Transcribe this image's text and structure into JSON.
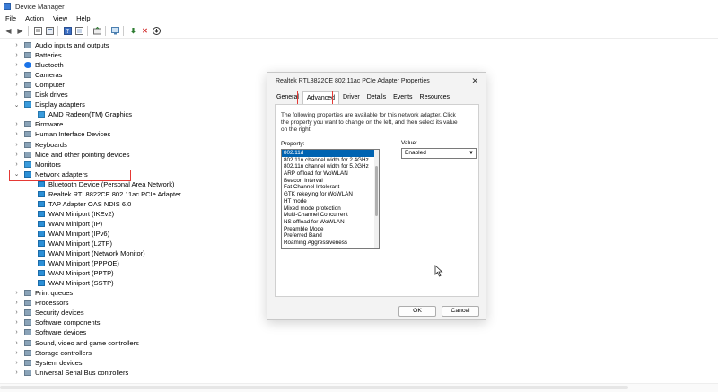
{
  "window": {
    "title": "Device Manager"
  },
  "menu": [
    "File",
    "Action",
    "View",
    "Help"
  ],
  "tree": [
    {
      "label": "Audio inputs and outputs",
      "icon": "speaker-icon",
      "expanded": false,
      "level": 0
    },
    {
      "label": "Batteries",
      "icon": "battery-icon",
      "expanded": false,
      "level": 0
    },
    {
      "label": "Bluetooth",
      "icon": "bluetooth-icon",
      "expanded": false,
      "level": 0
    },
    {
      "label": "Cameras",
      "icon": "camera-icon",
      "expanded": false,
      "level": 0
    },
    {
      "label": "Computer",
      "icon": "computer-icon",
      "expanded": false,
      "level": 0
    },
    {
      "label": "Disk drives",
      "icon": "disk-icon",
      "expanded": false,
      "level": 0
    },
    {
      "label": "Display adapters",
      "icon": "display-icon",
      "expanded": true,
      "level": 0
    },
    {
      "label": "AMD Radeon(TM) Graphics",
      "icon": "display-icon",
      "level": 1
    },
    {
      "label": "Firmware",
      "icon": "firmware-icon",
      "expanded": false,
      "level": 0
    },
    {
      "label": "Human Interface Devices",
      "icon": "hid-icon",
      "expanded": false,
      "level": 0
    },
    {
      "label": "Keyboards",
      "icon": "keyboard-icon",
      "expanded": false,
      "level": 0
    },
    {
      "label": "Mice and other pointing devices",
      "icon": "mouse-icon",
      "expanded": false,
      "level": 0
    },
    {
      "label": "Monitors",
      "icon": "monitor-icon",
      "expanded": false,
      "level": 0
    },
    {
      "label": "Network adapters",
      "icon": "network-icon",
      "expanded": true,
      "level": 0
    },
    {
      "label": "Bluetooth Device (Personal Area Network)",
      "icon": "network-icon",
      "level": 1
    },
    {
      "label": "Realtek RTL8822CE 802.11ac PCIe Adapter",
      "icon": "network-icon",
      "level": 1
    },
    {
      "label": "TAP Adapter OAS NDIS 6.0",
      "icon": "network-icon",
      "level": 1
    },
    {
      "label": "WAN Miniport (IKEv2)",
      "icon": "network-icon",
      "level": 1
    },
    {
      "label": "WAN Miniport (IP)",
      "icon": "network-icon",
      "level": 1
    },
    {
      "label": "WAN Miniport (IPv6)",
      "icon": "network-icon",
      "level": 1
    },
    {
      "label": "WAN Miniport (L2TP)",
      "icon": "network-icon",
      "level": 1
    },
    {
      "label": "WAN Miniport (Network Monitor)",
      "icon": "network-icon",
      "level": 1
    },
    {
      "label": "WAN Miniport (PPPOE)",
      "icon": "network-icon",
      "level": 1
    },
    {
      "label": "WAN Miniport (PPTP)",
      "icon": "network-icon",
      "level": 1
    },
    {
      "label": "WAN Miniport (SSTP)",
      "icon": "network-icon",
      "level": 1
    },
    {
      "label": "Print queues",
      "icon": "printer-icon",
      "expanded": false,
      "level": 0
    },
    {
      "label": "Processors",
      "icon": "processor-icon",
      "expanded": false,
      "level": 0
    },
    {
      "label": "Security devices",
      "icon": "security-icon",
      "expanded": false,
      "level": 0
    },
    {
      "label": "Software components",
      "icon": "software-icon",
      "expanded": false,
      "level": 0
    },
    {
      "label": "Software devices",
      "icon": "software-icon",
      "expanded": false,
      "level": 0
    },
    {
      "label": "Sound, video and game controllers",
      "icon": "sound-icon",
      "expanded": false,
      "level": 0
    },
    {
      "label": "Storage controllers",
      "icon": "storage-icon",
      "expanded": false,
      "level": 0
    },
    {
      "label": "System devices",
      "icon": "system-icon",
      "expanded": false,
      "level": 0
    },
    {
      "label": "Universal Serial Bus controllers",
      "icon": "usb-icon",
      "expanded": false,
      "level": 0
    }
  ],
  "dialog": {
    "title": "Realtek RTL8822CE 802.11ac PCIe Adapter Properties",
    "close": "✕",
    "tabs": [
      "General",
      "Advanced",
      "Driver",
      "Details",
      "Events",
      "Resources"
    ],
    "active_tab": "Advanced",
    "description": "The following properties are available for this network adapter. Click the property you want to change on the left, and then select its value on the right.",
    "property_label": "Property:",
    "value_label": "Value:",
    "properties": [
      "802.11d",
      "802.11n channel width for 2.4GHz",
      "802.11n channel width for 5.2GHz",
      "ARP offload for WoWLAN",
      "Beacon Interval",
      "Fat Channel Intolerant",
      "GTK rekeying for WoWLAN",
      "HT mode",
      "Mixed mode protection",
      "Multi-Channel Concurrent",
      "NS offload for WoWLAN",
      "Preamble Mode",
      "Preferred Band",
      "Roaming Aggressiveness"
    ],
    "selected_property": "802.11d",
    "value": "Enabled",
    "ok_label": "OK",
    "cancel_label": "Cancel"
  },
  "colors": {
    "highlight": "#e53935",
    "selection": "#0063b1",
    "network_icon": "#2b8fd6"
  }
}
